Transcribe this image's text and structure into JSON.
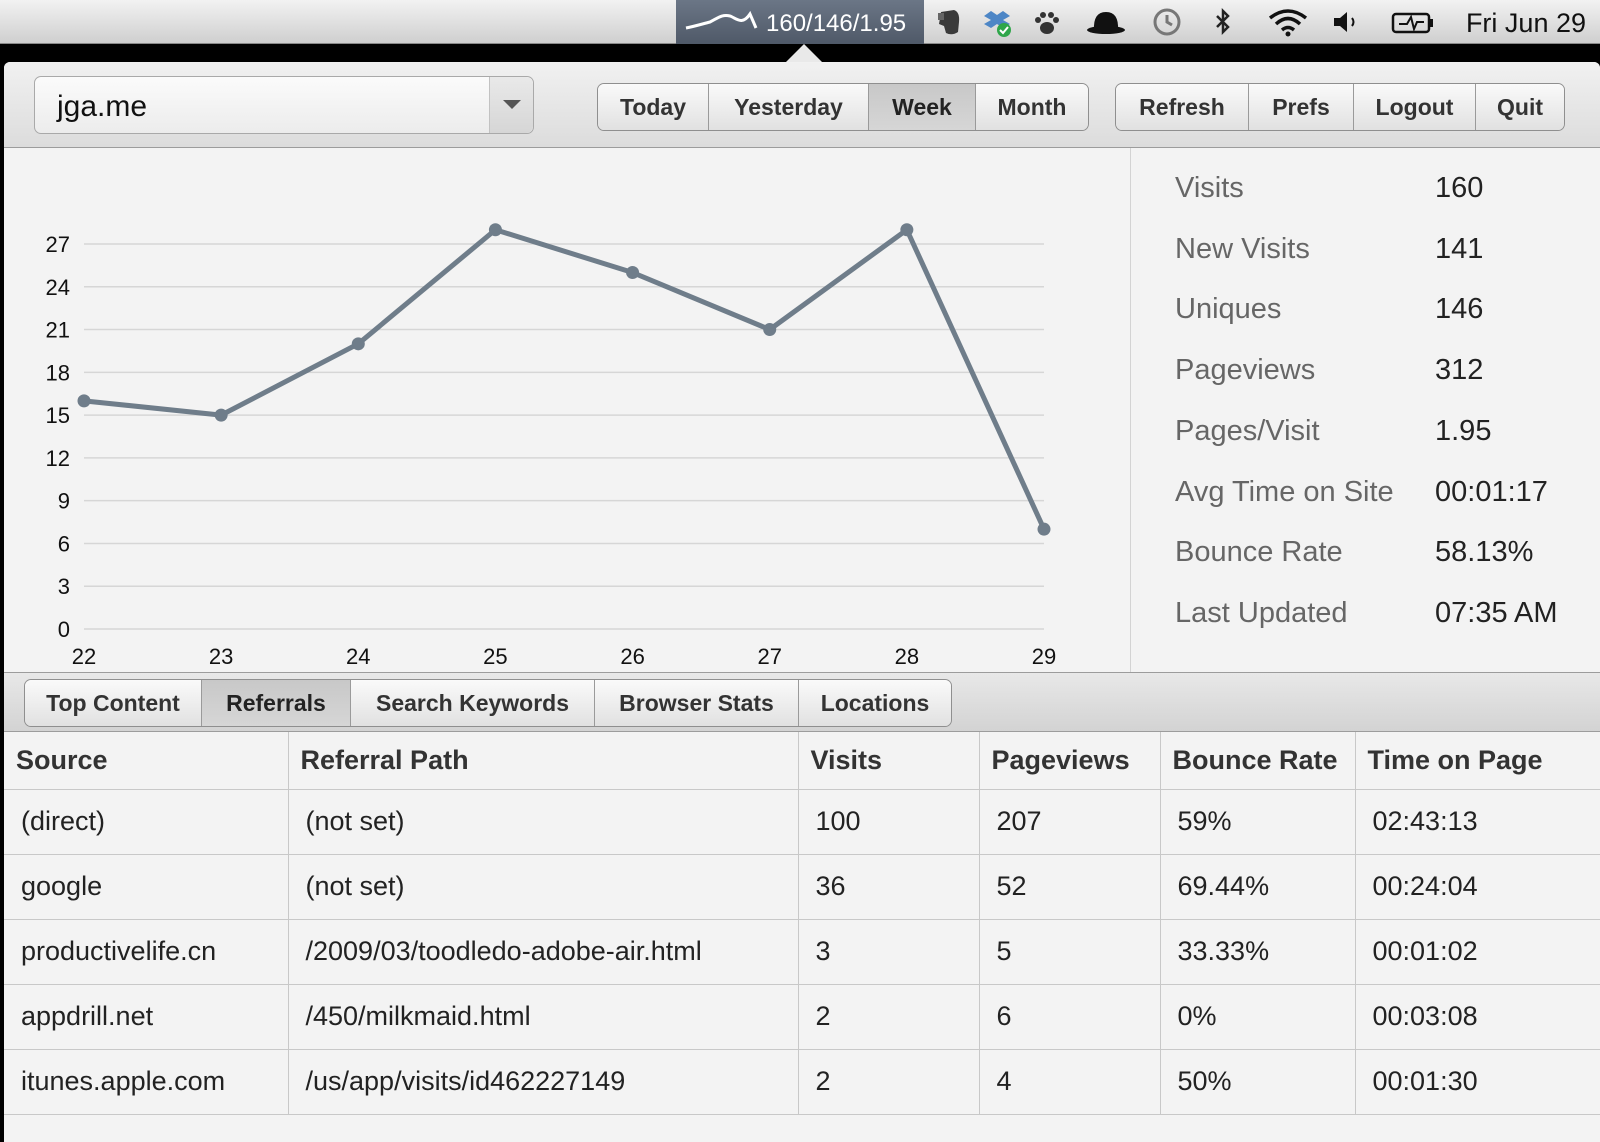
{
  "menubar": {
    "status_text": "160/146/1.95",
    "clock": "Fri Jun 29",
    "icons": [
      "sparkline-icon",
      "evernote-icon",
      "dropbox-icon",
      "paw-icon",
      "bowler-hat-icon",
      "time-machine-icon",
      "bluetooth-icon",
      "wifi-icon",
      "volume-icon",
      "battery-icon"
    ]
  },
  "toolbar": {
    "site": "jga.me",
    "ranges": [
      "Today",
      "Yesterday",
      "Week",
      "Month"
    ],
    "selected_range": "Week",
    "actions": [
      "Refresh",
      "Prefs",
      "Logout",
      "Quit"
    ]
  },
  "chart_data": {
    "type": "line",
    "x": [
      "22",
      "23",
      "24",
      "25",
      "26",
      "27",
      "28",
      "29"
    ],
    "series": [
      {
        "values": [
          16,
          15,
          20,
          28,
          25,
          21,
          28,
          7
        ]
      }
    ],
    "yticks": [
      "0",
      "3",
      "6",
      "9",
      "12",
      "15",
      "18",
      "21",
      "24",
      "27"
    ],
    "ylim": [
      0,
      27
    ],
    "grid": true,
    "color": "#6f7d8a"
  },
  "stats": [
    {
      "label": "Visits",
      "value": "160"
    },
    {
      "label": "New Visits",
      "value": "141"
    },
    {
      "label": "Uniques",
      "value": "146"
    },
    {
      "label": "Pageviews",
      "value": "312"
    },
    {
      "label": "Pages/Visit",
      "value": "1.95"
    },
    {
      "label": "Avg Time on Site",
      "value": "00:01:17"
    },
    {
      "label": "Bounce Rate",
      "value": "58.13%"
    },
    {
      "label": "Last Updated",
      "value": "07:35 AM"
    }
  ],
  "tabs": [
    "Top Content",
    "Referrals",
    "Search Keywords",
    "Browser Stats",
    "Locations"
  ],
  "selected_tab": "Referrals",
  "table": {
    "headers": [
      "Source",
      "Referral Path",
      "Visits",
      "Pageviews",
      "Bounce Rate",
      "Time on Page"
    ],
    "rows": [
      [
        "(direct)",
        "(not set)",
        "100",
        "207",
        "59%",
        "02:43:13"
      ],
      [
        "google",
        "(not set)",
        "36",
        "52",
        "69.44%",
        "00:24:04"
      ],
      [
        "productivelife.cn",
        "/2009/03/toodledo-adobe-air.html",
        "3",
        "5",
        "33.33%",
        "00:01:02"
      ],
      [
        "appdrill.net",
        "/450/milkmaid.html",
        "2",
        "6",
        "0%",
        "00:03:08"
      ],
      [
        "itunes.apple.com",
        "/us/app/visits/id462227149",
        "2",
        "4",
        "50%",
        "00:01:30"
      ]
    ]
  }
}
